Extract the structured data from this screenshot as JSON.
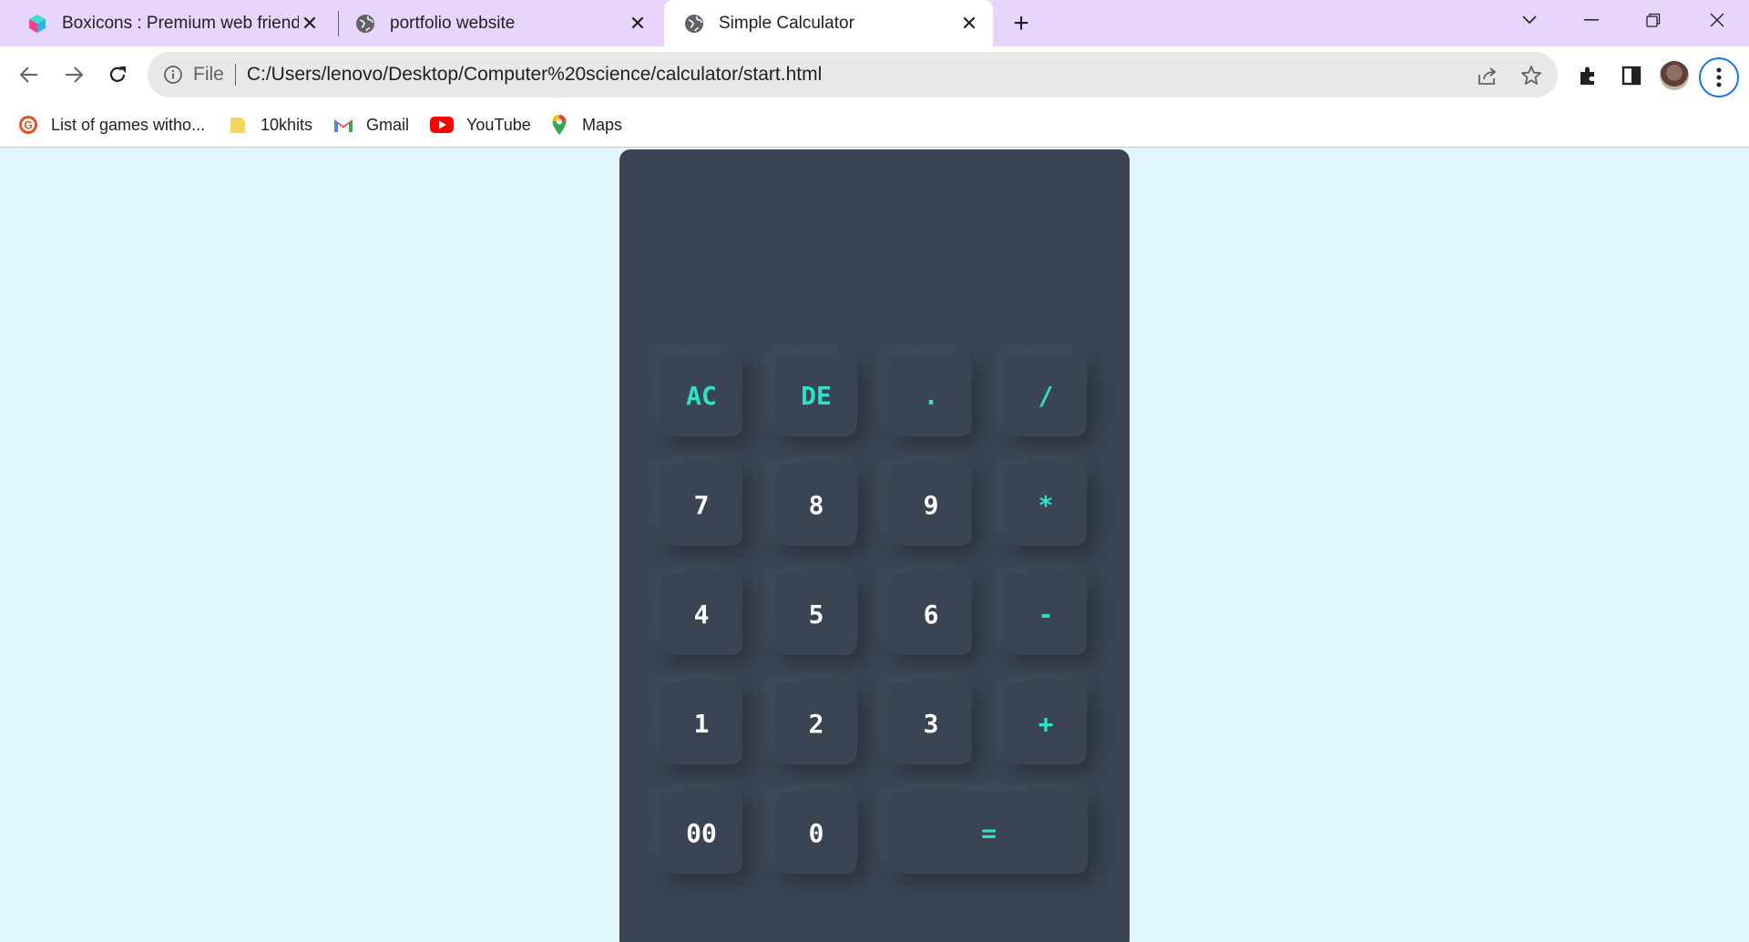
{
  "tabs": [
    {
      "title": "Boxicons : Premium web friendly",
      "active": false,
      "icon": "boxicons-logo-icon"
    },
    {
      "title": "portfolio website",
      "active": false,
      "icon": "globe-icon"
    },
    {
      "title": "Simple Calculator",
      "active": true,
      "icon": "globe-icon"
    }
  ],
  "omnibox": {
    "scheme": "File",
    "url": "C:/Users/lenovo/Desktop/Computer%20science/calculator/start.html"
  },
  "bookmarks": [
    {
      "label": "List of games witho...",
      "icon": "grammarly-icon"
    },
    {
      "label": "10khits",
      "icon": "folder-icon"
    },
    {
      "label": "Gmail",
      "icon": "gmail-icon"
    },
    {
      "label": "YouTube",
      "icon": "youtube-icon"
    },
    {
      "label": "Maps",
      "icon": "maps-icon"
    }
  ],
  "calculator": {
    "display": "",
    "keys": {
      "ac": "AC",
      "de": "DE",
      "dot": ".",
      "divide": "/",
      "seven": "7",
      "eight": "8",
      "nine": "9",
      "multiply": "*",
      "four": "4",
      "five": "5",
      "six": "6",
      "minus": "-",
      "one": "1",
      "two": "2",
      "three": "3",
      "plus": "+",
      "double_zero": "00",
      "zero": "0",
      "equals": "="
    }
  },
  "colors": {
    "page_bg": "#e1f5fe",
    "calc_bg": "#3a4452",
    "operator_text": "#2de0c8",
    "digit_text": "#ffffff",
    "tab_strip": "#e8d5fb"
  }
}
